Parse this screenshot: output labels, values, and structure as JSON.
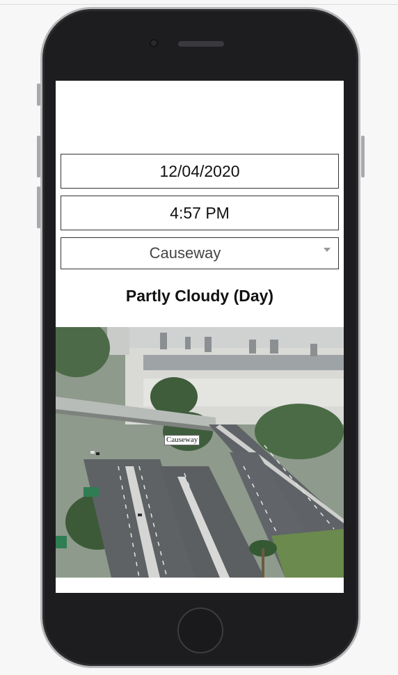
{
  "form": {
    "date_value": "12/04/2020",
    "time_value": "4:57 PM",
    "location_selected": "Causeway"
  },
  "weather": {
    "condition": "Partly Cloudy (Day)"
  },
  "camera": {
    "overlay_label": "Causeway"
  },
  "colors": {
    "screen_background": "#ffffff",
    "field_border": "#333333",
    "phone_body": "#1d1d1f"
  }
}
